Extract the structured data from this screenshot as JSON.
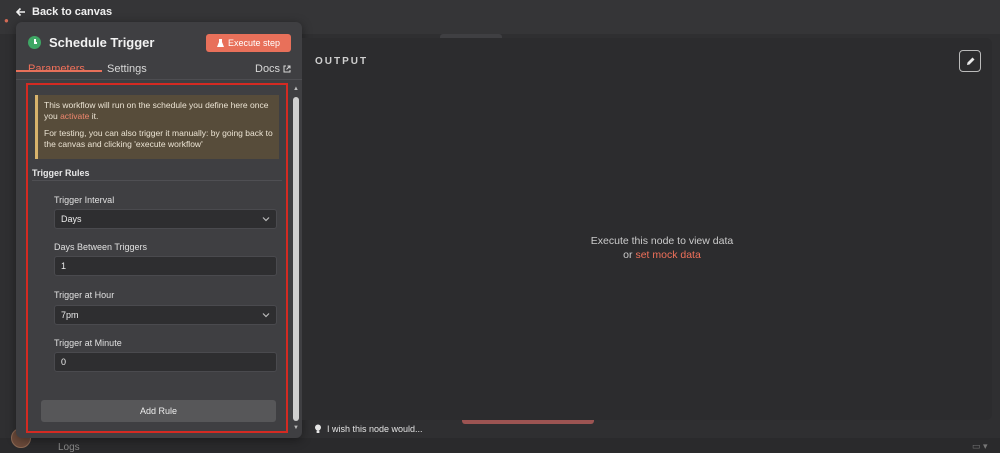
{
  "back_link": "Back to canvas",
  "node": {
    "title": "Schedule Trigger",
    "execute_label": "Execute step"
  },
  "tabs": {
    "parameters": "Parameters",
    "settings": "Settings",
    "docs": "Docs"
  },
  "callout": {
    "line1_a": "This workflow will run on the schedule you define here once you ",
    "line1_link": "activate",
    "line1_b": " it.",
    "line2": "For testing, you can also trigger it manually: by going back to the canvas and clicking 'execute workflow'"
  },
  "rules": {
    "section_title": "Trigger Rules",
    "trigger_interval_label": "Trigger Interval",
    "trigger_interval_value": "Days",
    "days_between_label": "Days Between Triggers",
    "days_between_value": "1",
    "trigger_hour_label": "Trigger at Hour",
    "trigger_hour_value": "7pm",
    "trigger_minute_label": "Trigger at Minute",
    "trigger_minute_value": "0",
    "add_rule_label": "Add Rule"
  },
  "output": {
    "title": "OUTPUT",
    "empty_line1": "Execute this node to view data",
    "empty_or": "or ",
    "empty_link": "set mock data"
  },
  "footer": {
    "wish": "I wish this node would...",
    "logs": "Logs"
  },
  "colors": {
    "accent": "#e8705a",
    "highlight_frame": "#d42a22",
    "trigger_icon": "#3fa765"
  }
}
